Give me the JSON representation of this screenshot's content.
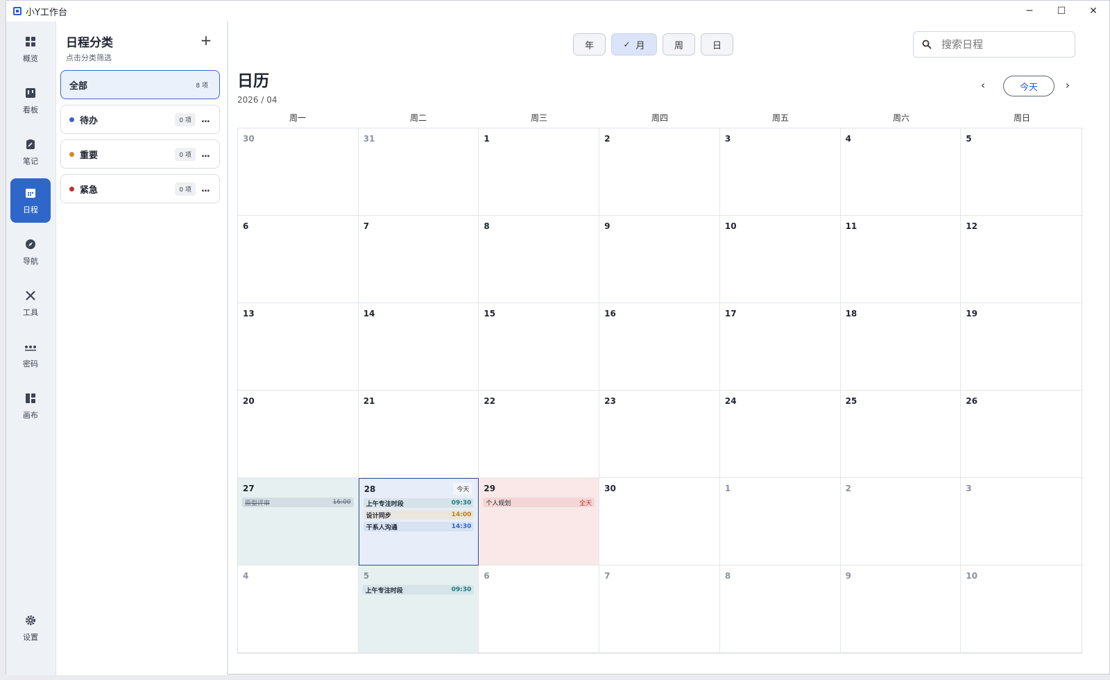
{
  "window": {
    "title": "小Y工作台",
    "controls": [
      "─",
      "☐",
      "✕"
    ]
  },
  "rail": {
    "items": [
      {
        "label": "概览",
        "icon": "dashboard-icon"
      },
      {
        "label": "看板",
        "icon": "kanban-icon"
      },
      {
        "label": "笔记",
        "icon": "note-icon"
      },
      {
        "label": "日程",
        "icon": "calendar-icon",
        "active": true
      },
      {
        "label": "导航",
        "icon": "compass-icon"
      },
      {
        "label": "工具",
        "icon": "tools-icon"
      },
      {
        "label": "密码",
        "icon": "password-icon"
      },
      {
        "label": "画布",
        "icon": "canvas-icon"
      }
    ],
    "settings": {
      "label": "设置",
      "icon": "gear-icon"
    }
  },
  "categories": {
    "title": "日程分类",
    "subtitle": "点击分类筛选",
    "add": "+",
    "items": [
      {
        "name": "全部",
        "count": "8 项",
        "active": true
      },
      {
        "name": "待办",
        "count": "0 项",
        "color": "#2f66c9"
      },
      {
        "name": "重要",
        "count": "0 项",
        "color": "#d08a2a"
      },
      {
        "name": "紧急",
        "count": "0 项",
        "color": "#c0322b"
      }
    ],
    "more_label": "..."
  },
  "toolbar": {
    "views": [
      {
        "label": "年"
      },
      {
        "label": "月",
        "active": true,
        "check": "✓"
      },
      {
        "label": "周"
      },
      {
        "label": "日"
      }
    ],
    "search_placeholder": "搜索日程"
  },
  "calendar": {
    "title": "日历",
    "month": "2026 / 04",
    "today_button": "今天",
    "prev": "‹",
    "next": "›",
    "weekdays": [
      "周一",
      "周二",
      "周三",
      "周四",
      "周五",
      "周六",
      "周日"
    ],
    "today_tag": "今天",
    "days": [
      {
        "n": "30",
        "muted": true
      },
      {
        "n": "31",
        "muted": true
      },
      {
        "n": "1"
      },
      {
        "n": "2"
      },
      {
        "n": "3"
      },
      {
        "n": "4"
      },
      {
        "n": "5"
      },
      {
        "n": "6"
      },
      {
        "n": "7"
      },
      {
        "n": "8"
      },
      {
        "n": "9"
      },
      {
        "n": "10"
      },
      {
        "n": "11"
      },
      {
        "n": "12"
      },
      {
        "n": "13"
      },
      {
        "n": "14"
      },
      {
        "n": "15"
      },
      {
        "n": "16"
      },
      {
        "n": "17"
      },
      {
        "n": "18"
      },
      {
        "n": "19"
      },
      {
        "n": "20"
      },
      {
        "n": "21"
      },
      {
        "n": "22"
      },
      {
        "n": "23"
      },
      {
        "n": "24"
      },
      {
        "n": "25"
      },
      {
        "n": "26"
      },
      {
        "n": "27",
        "style": "teal",
        "events": [
          {
            "title": "原型评审",
            "time": "16:00",
            "kind": "done"
          }
        ]
      },
      {
        "n": "28",
        "style": "today",
        "events": [
          {
            "title": "上午专注时段",
            "time": "09:30",
            "kind": "focus"
          },
          {
            "title": "设计同步",
            "time": "14:00",
            "kind": "design"
          },
          {
            "title": "干系人沟通",
            "time": "14:30",
            "kind": "sync"
          }
        ]
      },
      {
        "n": "29",
        "style": "pink",
        "events": [
          {
            "title": "个人规划",
            "time": "全天",
            "kind": "personal"
          }
        ]
      },
      {
        "n": "30"
      },
      {
        "n": "1",
        "muted": true
      },
      {
        "n": "2",
        "muted": true
      },
      {
        "n": "3",
        "muted": true
      },
      {
        "n": "4",
        "muted": true
      },
      {
        "n": "5",
        "muted": true,
        "style": "teal",
        "events": [
          {
            "title": "上午专注时段",
            "time": "09:30",
            "kind": "focus"
          }
        ]
      },
      {
        "n": "6",
        "muted": true
      },
      {
        "n": "7",
        "muted": true
      },
      {
        "n": "8",
        "muted": true
      },
      {
        "n": "9",
        "muted": true
      },
      {
        "n": "10",
        "muted": true
      }
    ]
  }
}
